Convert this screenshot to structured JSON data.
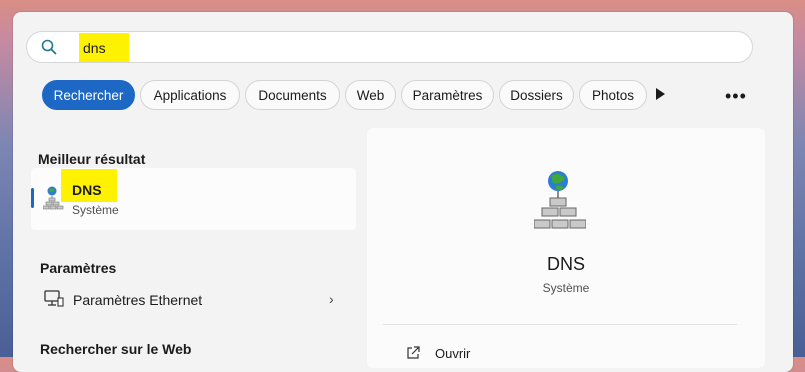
{
  "search": {
    "value": "dns"
  },
  "filters": [
    "Rechercher",
    "Applications",
    "Documents",
    "Web",
    "Paramètres",
    "Dossiers",
    "Photos"
  ],
  "left": {
    "best_header": "Meilleur résultat",
    "best": {
      "title": "DNS",
      "subtitle": "Système",
      "icon": "dns-server-icon"
    },
    "settings_header": "Paramètres",
    "settings_item": {
      "label": "Paramètres Ethernet",
      "icon": "monitor-network-icon"
    },
    "web_header": "Rechercher sur le Web"
  },
  "preview": {
    "title": "DNS",
    "subtitle": "Système",
    "action_open": "Ouvrir"
  },
  "colors": {
    "accent": "#1c68c4",
    "highlight": "#fff200"
  }
}
